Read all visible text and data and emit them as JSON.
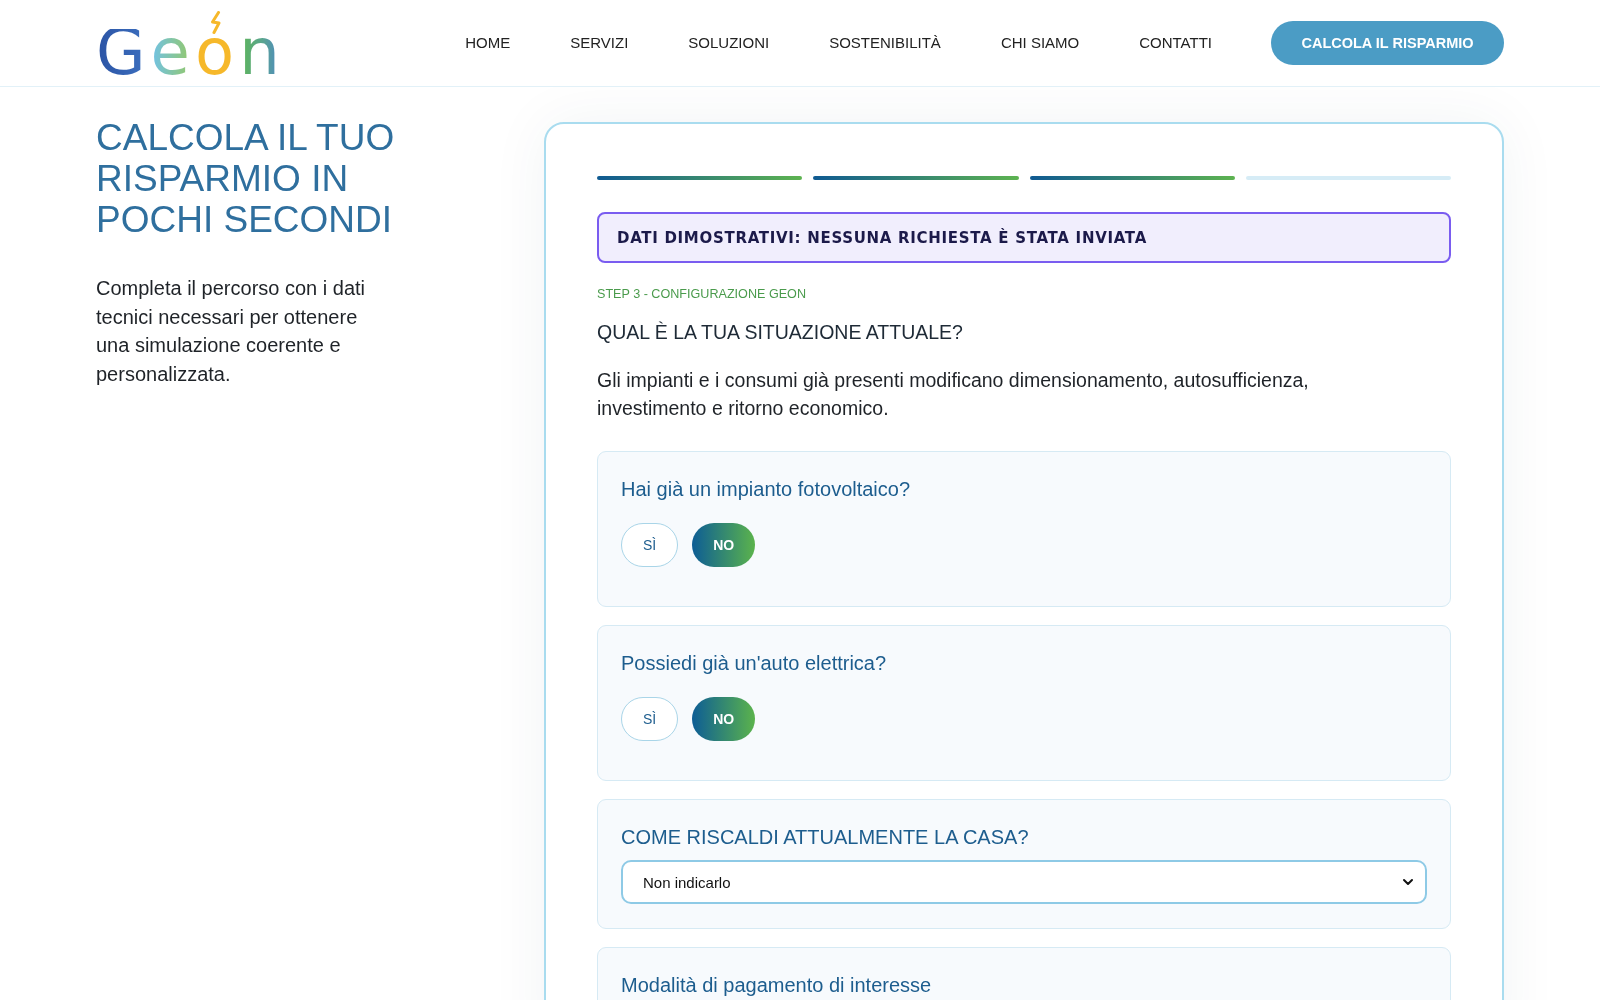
{
  "header": {
    "logo": "Geon",
    "nav": [
      {
        "label": "HOME"
      },
      {
        "label": "SERVIZI"
      },
      {
        "label": "SOLUZIONI"
      },
      {
        "label": "SOSTENIBILITÀ"
      },
      {
        "label": "CHI SIAMO"
      },
      {
        "label": "CONTATTI"
      }
    ],
    "cta": "CALCOLA IL RISPARMIO"
  },
  "intro": {
    "title": "CALCOLA IL TUO RISPARMIO IN POCHI SECONDI",
    "text": "Completa il percorso con i dati tecnici necessari per ottenere una simulazione coerente e personalizzata."
  },
  "wizard": {
    "progress": [
      {
        "completed": true
      },
      {
        "completed": true
      },
      {
        "completed": true
      },
      {
        "completed": false
      }
    ],
    "notice": "DATI DIMOSTRATIVI: NESSUNA RICHIESTA È STATA INVIATA",
    "step_label": "STEP 3 - CONFIGURAZIONE GEON",
    "question": "QUAL È LA TUA SITUAZIONE ATTUALE?",
    "description": "Gli impianti e i consumi già presenti modificano dimensionamento, autosufficienza, investimento e ritorno economico.",
    "fields": [
      {
        "kind": "choice",
        "label": "Hai già un impianto fotovoltaico?",
        "options": [
          {
            "label": "SÌ",
            "selected": false
          },
          {
            "label": "NO",
            "selected": true
          }
        ]
      },
      {
        "kind": "choice",
        "label": "Possiedi già un'auto elettrica?",
        "options": [
          {
            "label": "SÌ",
            "selected": false
          },
          {
            "label": "NO",
            "selected": true
          }
        ]
      },
      {
        "kind": "select",
        "label": "COME RISCALDI ATTUALMENTE LA CASA?",
        "value": "Non indicarlo"
      },
      {
        "kind": "title",
        "label": "Modalità di pagamento di interesse"
      }
    ]
  }
}
